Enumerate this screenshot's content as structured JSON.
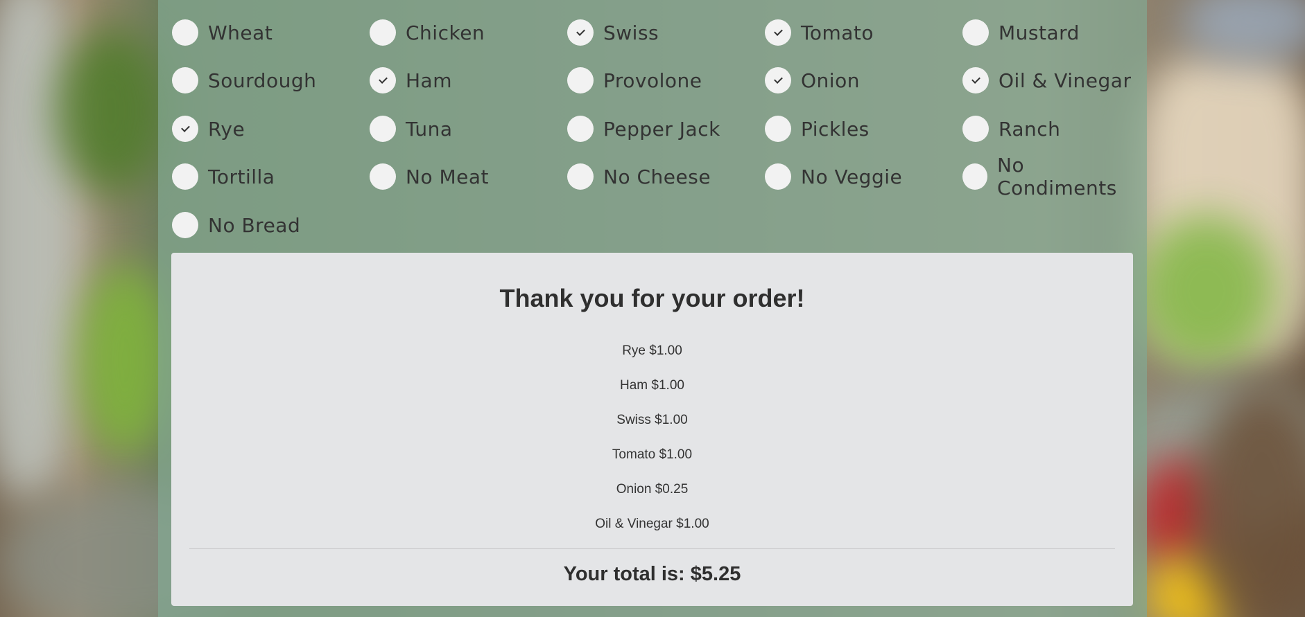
{
  "options": [
    {
      "label": "Wheat",
      "checked": false
    },
    {
      "label": "Chicken",
      "checked": false
    },
    {
      "label": "Swiss",
      "checked": true
    },
    {
      "label": "Tomato",
      "checked": true
    },
    {
      "label": "Mustard",
      "checked": false
    },
    {
      "label": "Sourdough",
      "checked": false
    },
    {
      "label": "Ham",
      "checked": true
    },
    {
      "label": "Provolone",
      "checked": false
    },
    {
      "label": "Onion",
      "checked": true
    },
    {
      "label": "Oil & Vinegar",
      "checked": true
    },
    {
      "label": "Rye",
      "checked": true
    },
    {
      "label": "Tuna",
      "checked": false
    },
    {
      "label": "Pepper Jack",
      "checked": false
    },
    {
      "label": "Pickles",
      "checked": false
    },
    {
      "label": "Ranch",
      "checked": false
    },
    {
      "label": "Tortilla",
      "checked": false
    },
    {
      "label": "No Meat",
      "checked": false
    },
    {
      "label": "No Cheese",
      "checked": false
    },
    {
      "label": "No Veggie",
      "checked": false
    },
    {
      "label": "No Condiments",
      "checked": false
    },
    {
      "label": "No Bread",
      "checked": false
    }
  ],
  "receipt": {
    "title": "Thank you for your order!",
    "items": [
      "Rye $1.00",
      "Ham $1.00",
      "Swiss $1.00",
      "Tomato $1.00",
      "Onion $0.25",
      "Oil & Vinegar $1.00"
    ],
    "total": "Your total is: $5.25"
  }
}
